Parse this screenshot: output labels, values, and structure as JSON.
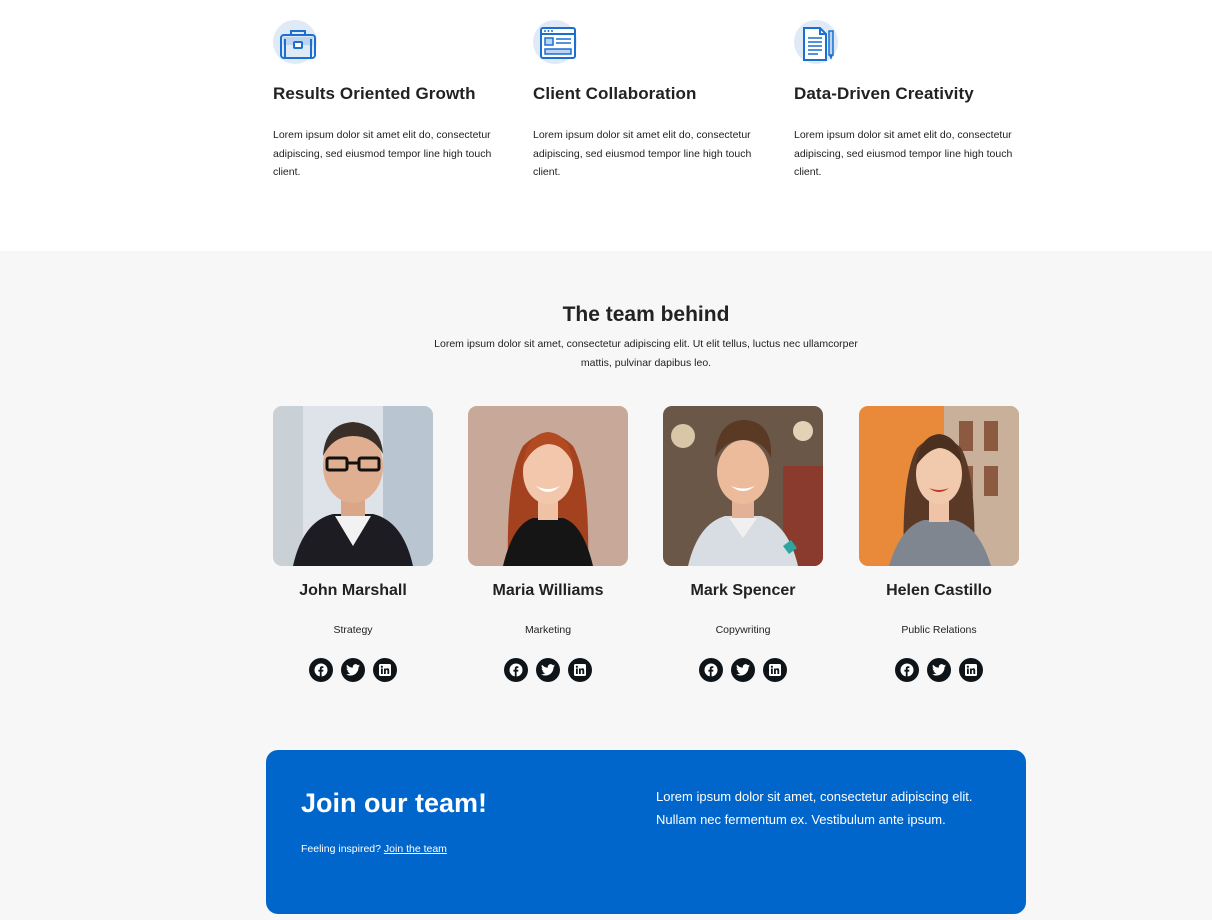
{
  "features": [
    {
      "icon": "briefcase-icon",
      "title": "Results Oriented Growth",
      "text": "Lorem ipsum dolor sit amet elit do, consectetur adipiscing, sed eiusmod tempor line high touch client."
    },
    {
      "icon": "browser-window-icon",
      "title": "Client Collaboration",
      "text": "Lorem ipsum dolor sit amet elit do, consectetur adipiscing, sed eiusmod tempor line high touch client."
    },
    {
      "icon": "document-pencil-icon",
      "title": "Data-Driven Creativity",
      "text": "Lorem ipsum dolor sit amet elit do, consectetur adipiscing, sed eiusmod tempor line high touch client."
    }
  ],
  "team": {
    "heading": "The team behind",
    "intro": "Lorem ipsum dolor sit amet, consectetur adipiscing elit. Ut elit tellus, luctus nec ullamcorper mattis, pulvinar dapibus leo.",
    "members": [
      {
        "name": "John Marshall",
        "role": "Strategy"
      },
      {
        "name": "Maria Williams",
        "role": "Marketing"
      },
      {
        "name": "Mark Spencer",
        "role": "Copywriting"
      },
      {
        "name": "Helen Castillo",
        "role": "Public Relations"
      }
    ],
    "social_icons": [
      "facebook-icon",
      "twitter-icon",
      "linkedin-icon"
    ]
  },
  "join": {
    "heading": "Join our team!",
    "prompt": "Feeling inspired?",
    "link_label": "Join the team",
    "blurb": "Lorem ipsum dolor sit amet, consectetur adipiscing elit. Nullam nec fermentum ex. Vestibulum ante ipsum."
  },
  "colors": {
    "accent": "#0066cc",
    "icon_blue": "#1a6fd1",
    "section_bg": "#f7f7f7",
    "social_bg": "#0f1419"
  }
}
